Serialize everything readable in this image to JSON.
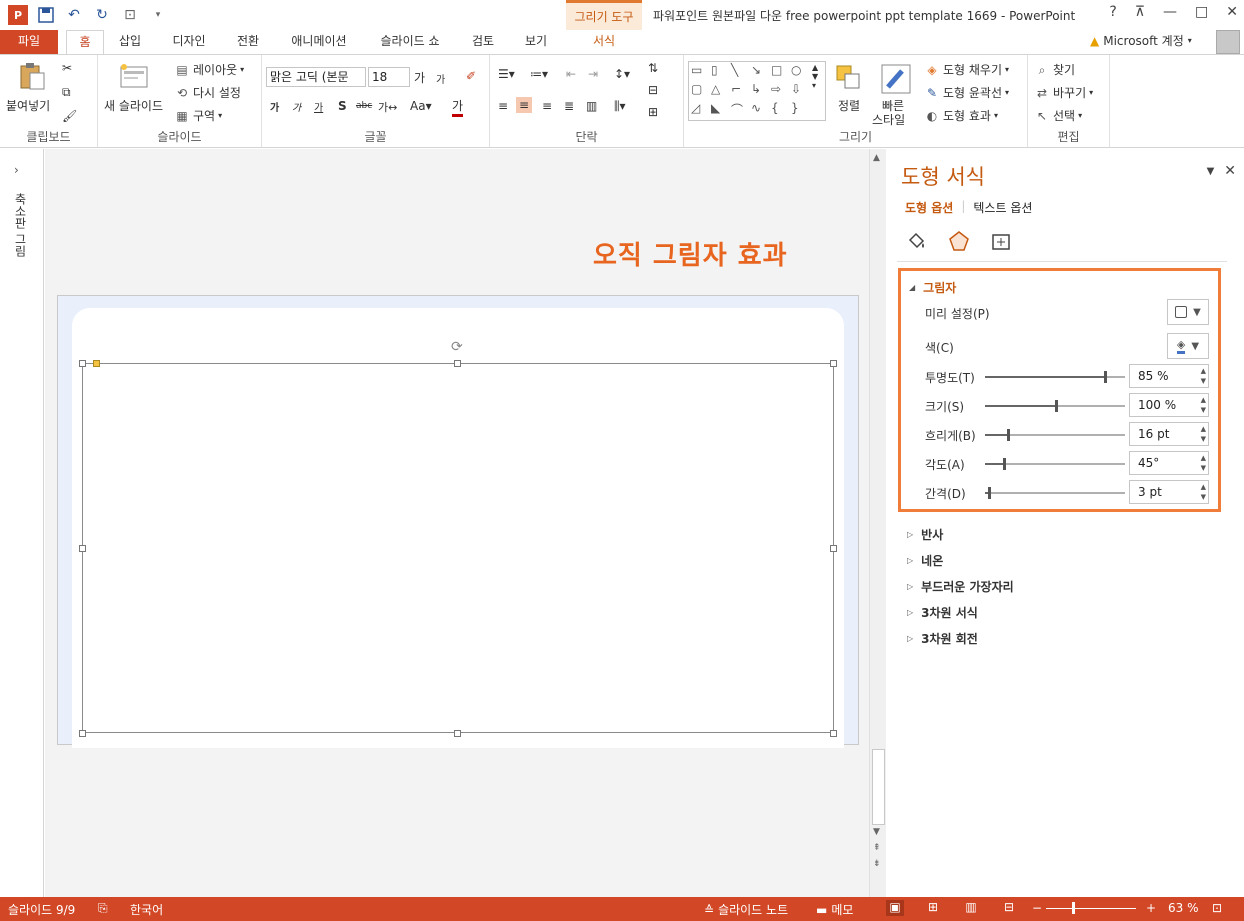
{
  "app": {
    "title": "파워포인트 원본파일 다운 free powerpoint ppt template 1669 - PowerPoint",
    "context_tab_group": "그리기 도구",
    "context_tab": "서식"
  },
  "tabs": [
    "파일",
    "홈",
    "삽입",
    "디자인",
    "전환",
    "애니메이션",
    "슬라이드 쇼",
    "검토",
    "보기"
  ],
  "account": "Microsoft 계정",
  "ribbon": {
    "clipboard": {
      "paste": "붙여넣기",
      "label": "클립보드"
    },
    "slides": {
      "new_slide": "새 슬라이드",
      "layout": "레이아웃",
      "reset": "다시 설정",
      "section": "구역",
      "label": "슬라이드"
    },
    "font": {
      "family": "맑은 고딕 (본문",
      "size": "18",
      "label": "글꼴"
    },
    "paragraph": {
      "label": "단락"
    },
    "drawing": {
      "arrange": "정렬",
      "quick_styles": "빠른",
      "quick_styles2": "스타일",
      "fill": "도형 채우기",
      "outline": "도형 윤곽선",
      "effects": "도형 효과",
      "label": "그리기"
    },
    "editing": {
      "find": "찾기",
      "replace": "바꾸기",
      "select": "선택",
      "label": "편집"
    }
  },
  "left_pane": {
    "label": "축소판 그림"
  },
  "slide": {
    "title": "오직 그림자 효과"
  },
  "format_pane": {
    "title": "도형 서식",
    "tab_shape": "도형 옵션",
    "tab_text": "텍스트 옵션",
    "shadow": {
      "header": "그림자",
      "preset_label": "미리 설정(P)",
      "color_label": "색(C)",
      "transparency_label": "투명도(T)",
      "transparency_value": "85 %",
      "transparency_level": 0.85,
      "size_label": "크기(S)",
      "size_value": "100 %",
      "size_level": 0.5,
      "blur_label": "흐리게(B)",
      "blur_value": "16 pt",
      "blur_level": 0.16,
      "angle_label": "각도(A)",
      "angle_value": "45°",
      "angle_level": 0.125,
      "distance_label": "간격(D)",
      "distance_value": "3 pt",
      "distance_level": 0.02
    },
    "sections": [
      "반사",
      "네온",
      "부드러운 가장자리",
      "3차원 서식",
      "3차원 회전"
    ]
  },
  "status": {
    "slide": "슬라이드 9/9",
    "language": "한국어",
    "notes": "슬라이드 노트",
    "comments": "메모",
    "zoom": "63 %"
  },
  "colors": {
    "accent": "#d24726",
    "title_orange": "#e8651f",
    "highlight": "#f07c3a"
  }
}
